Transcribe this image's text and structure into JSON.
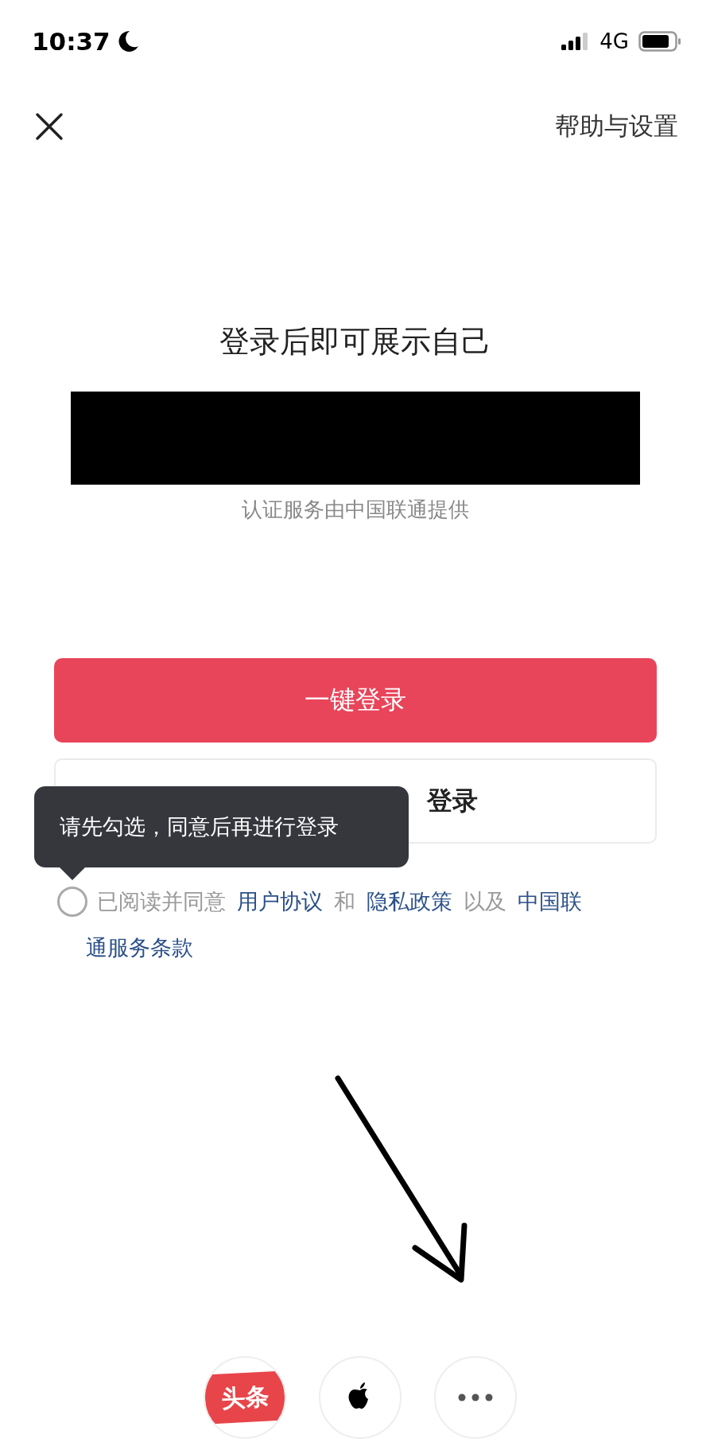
{
  "status_bar": {
    "time": "10:37",
    "network": "4G"
  },
  "header": {
    "help": "帮助与设置"
  },
  "title": "登录后即可展示自己",
  "provider_note": "认证服务由中国联通提供",
  "primary_button": "一键登录",
  "secondary_button": "登录",
  "tooltip": "请先勾选，同意后再进行登录",
  "agreement": {
    "checked": false,
    "parts": [
      {
        "kind": "text",
        "text": "已阅读并同意"
      },
      {
        "kind": "link",
        "text": "用户协议"
      },
      {
        "kind": "text",
        "text": "和"
      },
      {
        "kind": "link",
        "text": "隐私政策"
      },
      {
        "kind": "text",
        "text": "以及"
      },
      {
        "kind": "link",
        "text": "中国联"
      },
      {
        "kind": "link",
        "text": "通服务条款"
      }
    ]
  },
  "third_party": [
    {
      "kind": "toutiao",
      "label": "头条"
    },
    {
      "kind": "apple"
    },
    {
      "kind": "more"
    }
  ]
}
